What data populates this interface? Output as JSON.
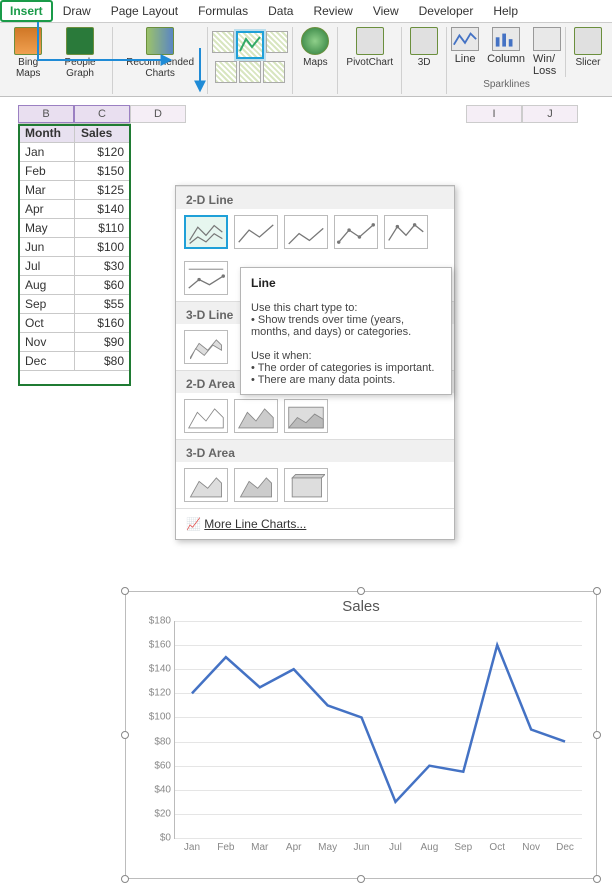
{
  "menubar": [
    "Insert",
    "Draw",
    "Page Layout",
    "Formulas",
    "Data",
    "Review",
    "View",
    "Developer",
    "Help"
  ],
  "ribbon": {
    "bing_maps": "Bing Maps",
    "people_graph": "People Graph",
    "recommended_charts": "Recommended Charts",
    "maps": "Maps",
    "pivotchart": "PivotChart",
    "three_d": "3D",
    "spark_line": "Line",
    "spark_column": "Column",
    "spark_winloss": "Win/ Loss",
    "sparklines_caption": "Sparklines",
    "slicer": "Slicer"
  },
  "columns": [
    "B",
    "C",
    "D",
    "I",
    "J"
  ],
  "table_headers": {
    "month": "Month",
    "sales": "Sales"
  },
  "rows": [
    {
      "month": "Jan",
      "sales": "$120"
    },
    {
      "month": "Feb",
      "sales": "$150"
    },
    {
      "month": "Mar",
      "sales": "$125"
    },
    {
      "month": "Apr",
      "sales": "$140"
    },
    {
      "month": "May",
      "sales": "$110"
    },
    {
      "month": "Jun",
      "sales": "$100"
    },
    {
      "month": "Jul",
      "sales": "$30"
    },
    {
      "month": "Aug",
      "sales": "$60"
    },
    {
      "month": "Sep",
      "sales": "$55"
    },
    {
      "month": "Oct",
      "sales": "$160"
    },
    {
      "month": "Nov",
      "sales": "$90"
    },
    {
      "month": "Dec",
      "sales": "$80"
    }
  ],
  "dropdown": {
    "s1": "2-D Line",
    "s2": "3-D Line",
    "s3": "2-D Area",
    "s4": "3-D Area",
    "more": "More Line Charts..."
  },
  "tooltip": {
    "title": "Line",
    "lead": "Use this chart type to:",
    "b1": "• Show trends over time (years, months, and days) or categories.",
    "use": "Use it when:",
    "b2": "• The order of categories is important.",
    "b3": "• There are many data points."
  },
  "chart": {
    "title": "Sales",
    "yticks": [
      "$0",
      "$20",
      "$40",
      "$60",
      "$80",
      "$100",
      "$120",
      "$140",
      "$160",
      "$180"
    ],
    "xticks": [
      "Jan",
      "Feb",
      "Mar",
      "Apr",
      "May",
      "Jun",
      "Jul",
      "Aug",
      "Sep",
      "Oct",
      "Nov",
      "Dec"
    ]
  },
  "chart_data": {
    "type": "line",
    "title": "Sales",
    "xlabel": "",
    "ylabel": "",
    "ylim": [
      0,
      180
    ],
    "categories": [
      "Jan",
      "Feb",
      "Mar",
      "Apr",
      "May",
      "Jun",
      "Jul",
      "Aug",
      "Sep",
      "Oct",
      "Nov",
      "Dec"
    ],
    "values": [
      120,
      150,
      125,
      140,
      110,
      100,
      30,
      60,
      55,
      160,
      90,
      80
    ]
  }
}
